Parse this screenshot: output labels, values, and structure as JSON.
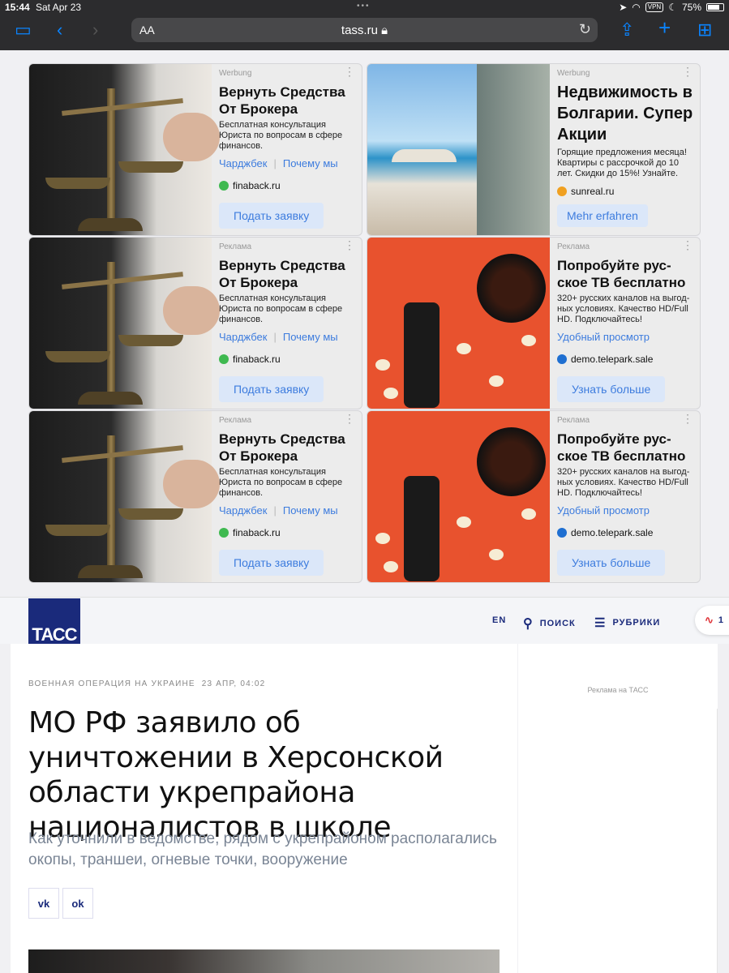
{
  "status_bar": {
    "time": "15:44",
    "date": "Sat Apr 23",
    "vpn": "VPN",
    "battery": "75%"
  },
  "browser": {
    "aa": "AA",
    "url": "tass.ru"
  },
  "ads": [
    {
      "label": "Werbung",
      "title": "Вернуть Средства От Брокера",
      "desc": "Бесплатная консультация Юриста по вопросам в сфере финансов.",
      "link1": "Чарджбек",
      "link2": "Почему мы",
      "domain": "finaback.ru",
      "cta": "Подать заявку"
    },
    {
      "label": "Werbung",
      "title": "Недвижимость в Болгарии. Супер Акции",
      "desc": "Горящие предложения месяца! Квартиры с рассрочкой до 10 лет. Скидки до 15%! Узнайте.",
      "domain": "sunreal.ru",
      "cta": "Mehr erfahren"
    },
    {
      "label": "Реклама",
      "title": "Вернуть Средства От Брокера",
      "desc": "Бесплатная консультация Юриста по вопросам в сфере финансов.",
      "link1": "Чарджбек",
      "link2": "Почему мы",
      "domain": "finaback.ru",
      "cta": "Подать заявку"
    },
    {
      "label": "Реклама",
      "title": "Попробуйте рус-ское ТВ бесплатно",
      "desc": "320+ русских каналов на выгод-ных условиях. Качество HD/Full HD. Подключайтесь!",
      "link1": "Удобный просмотр",
      "domain": "demo.telepark.sale",
      "cta": "Узнать больше"
    },
    {
      "label": "Реклама",
      "title": "Вернуть Средства От Брокера",
      "desc": "Бесплатная консультация Юриста по вопросам в сфере финансов.",
      "link1": "Чарджбек",
      "link2": "Почему мы",
      "domain": "finaback.ru",
      "cta": "Подать заявку"
    },
    {
      "label": "Реклама",
      "title": "Попробуйте рус-ское ТВ бесплатно",
      "desc": "320+ русских каналов на выгод-ных условиях. Качество HD/Full HD. Подключайтесь!",
      "link1": "Удобный просмотр",
      "domain": "demo.telepark.sale",
      "cta": "Узнать больше"
    }
  ],
  "tass": {
    "logo": "ТАСС",
    "nav_en": "EN",
    "nav_search": "ПОИСК",
    "nav_rubrics": "РУБРИКИ",
    "live_count": "1"
  },
  "article": {
    "category": "ВОЕННАЯ ОПЕРАЦИЯ НА УКРАИНЕ",
    "date": "23 АПР, 04:02",
    "headline": "МО РФ заявило об уничтожении в Херсонской области укрепрайона националистов в школе",
    "lead": "Как уточнили в ведомстве, рядом с укрепрайоном располагались окопы, траншеи, огневые точки, вооружение",
    "share_vk": "vk",
    "share_ok": "ok"
  },
  "sidebar": {
    "ad_note": "Реклама на ТАСС"
  },
  "colors": {
    "tass_blue": "#1a2a7b",
    "link_blue": "#3d7cde",
    "safari_blue": "#0a84ff"
  }
}
